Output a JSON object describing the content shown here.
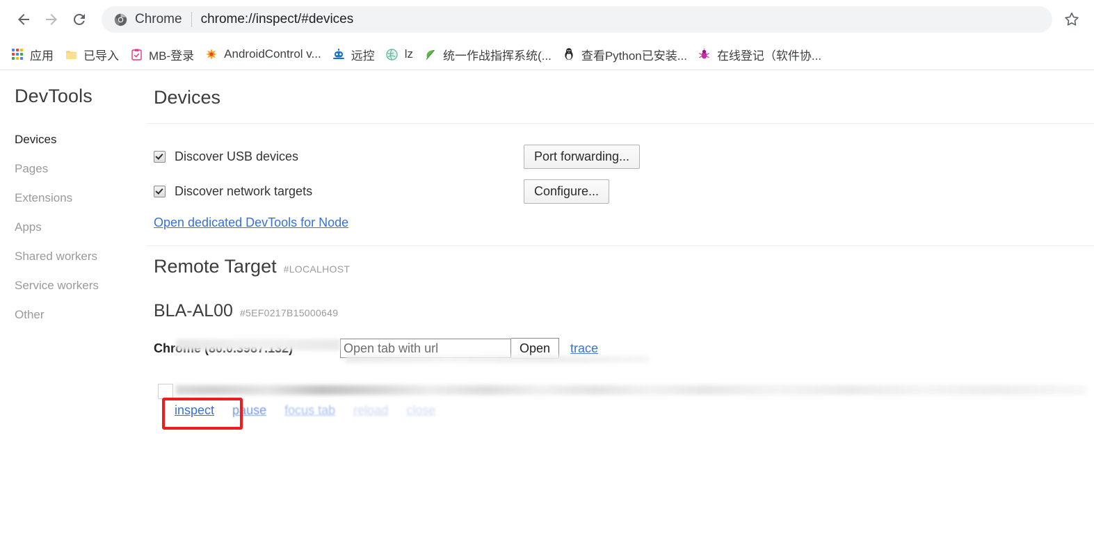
{
  "browser": {
    "back_icon": "back-arrow-icon",
    "forward_icon": "forward-arrow-icon",
    "reload_icon": "reload-icon",
    "omnibox": {
      "brand": "Chrome",
      "url": "chrome://inspect/#devices",
      "chrome_icon": "chrome-logo-icon"
    },
    "bookmark_star_icon": "star-icon",
    "bookmarks": [
      {
        "label": "应用",
        "icon": "apps-grid-icon"
      },
      {
        "label": "已导入",
        "icon": "folder-icon"
      },
      {
        "label": "MB-登录",
        "icon": "clipboard-icon"
      },
      {
        "label": "AndroidControl v...",
        "icon": "fireworks-icon"
      },
      {
        "label": "远控",
        "icon": "robot-icon"
      },
      {
        "label": "lz",
        "icon": "globe-icon"
      },
      {
        "label": "统一作战指挥系统(...",
        "icon": "leaf-icon"
      },
      {
        "label": "查看Python已安装...",
        "icon": "penguin-icon"
      },
      {
        "label": "在线登记（软件协...",
        "icon": "bug-icon"
      }
    ]
  },
  "devtools": {
    "sidebar": {
      "title": "DevTools",
      "items": [
        {
          "label": "Devices",
          "active": true
        },
        {
          "label": "Pages",
          "active": false
        },
        {
          "label": "Extensions",
          "active": false
        },
        {
          "label": "Apps",
          "active": false
        },
        {
          "label": "Shared workers",
          "active": false
        },
        {
          "label": "Service workers",
          "active": false
        },
        {
          "label": "Other",
          "active": false
        }
      ]
    },
    "main": {
      "page_title": "Devices",
      "settings": [
        {
          "label": "Discover USB devices",
          "checked": true,
          "button": "Port forwarding..."
        },
        {
          "label": "Discover network targets",
          "checked": true,
          "button": "Configure..."
        }
      ],
      "node_link": "Open dedicated DevTools for Node",
      "remote_target": {
        "title": "Remote Target",
        "subtitle": "#LOCALHOST",
        "device": {
          "name": "BLA-AL00",
          "serial": "#5EF0217B15000649",
          "browser": {
            "name": "Chrome (80.0.3987.132)",
            "url_placeholder": "Open tab with url",
            "url_value": "",
            "open_button": "Open",
            "trace_link": "trace"
          },
          "target_actions": [
            "inspect",
            "pause",
            "focus tab",
            "reload",
            "close"
          ]
        }
      }
    }
  },
  "annotation": {
    "highlight_color": "#ee1c1c",
    "highlight_target": "inspect"
  }
}
